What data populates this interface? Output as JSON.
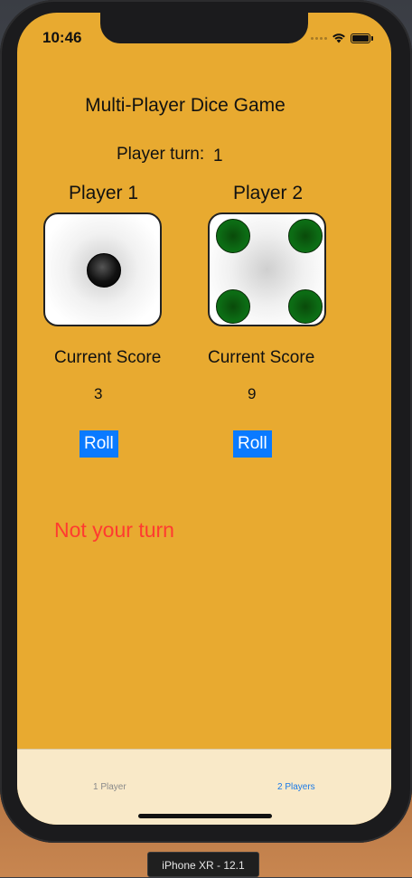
{
  "status_bar": {
    "time": "10:46"
  },
  "game": {
    "title": "Multi-Player Dice Game",
    "turn_label": "Player turn:",
    "turn_value": "1",
    "message": "Not your turn",
    "message_color": "#ff3b30",
    "players": [
      {
        "name": "Player 1",
        "die_value": 1,
        "score_label": "Current Score",
        "score": "3",
        "roll_label": "Roll"
      },
      {
        "name": "Player 2",
        "die_value": 4,
        "score_label": "Current Score",
        "score": "9",
        "roll_label": "Roll"
      }
    ]
  },
  "tabbar": {
    "tabs": [
      {
        "label": "1 Player",
        "active": false
      },
      {
        "label": "2 Players",
        "active": true
      }
    ]
  },
  "device_label": "iPhone XR - 12.1",
  "colors": {
    "background": "#e8aa30",
    "button": "#0a7aff",
    "active_tab": "#1a7ae8",
    "green_pip": "#0c6a14"
  }
}
